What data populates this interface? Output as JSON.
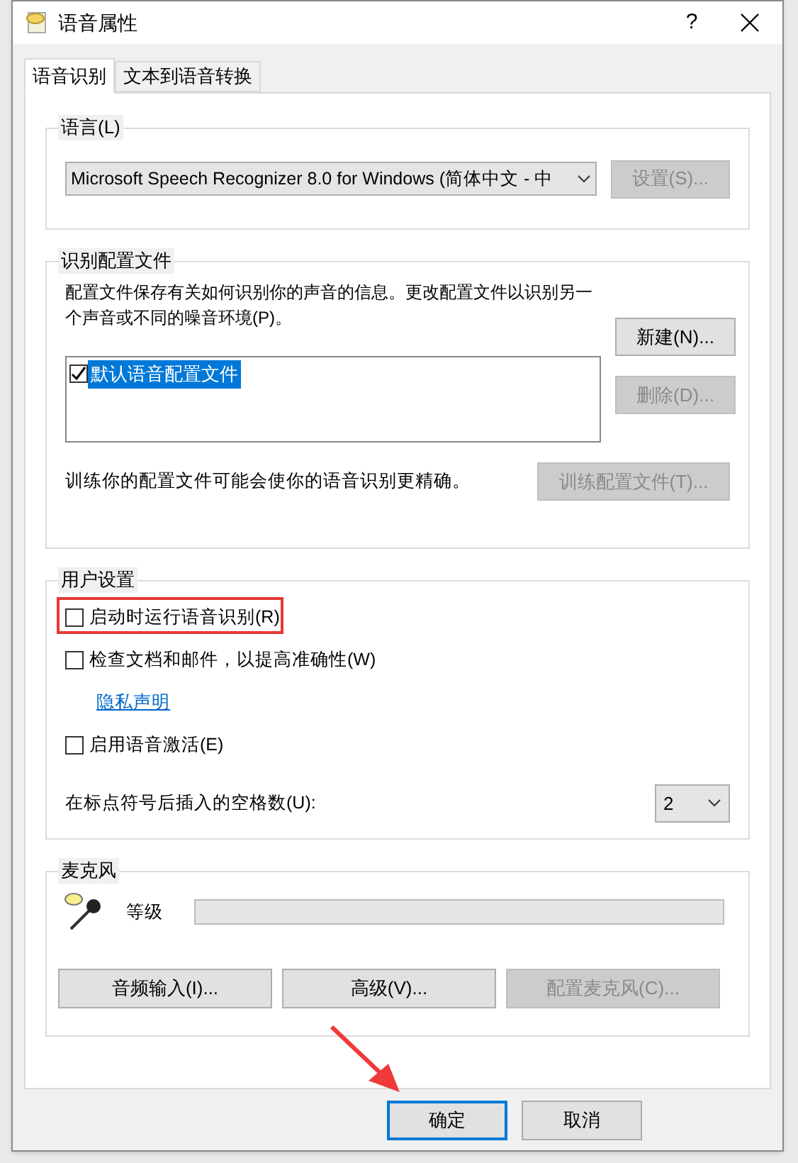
{
  "window": {
    "title": "语音属性",
    "help": "?"
  },
  "tabs": [
    {
      "label": "语音识别",
      "selected": true
    },
    {
      "label": "文本到语音转换",
      "selected": false
    }
  ],
  "language": {
    "legend": "语言(L)",
    "recognizer": "Microsoft Speech Recognizer 8.0 for Windows (简体中文 - 中",
    "settings_button": {
      "label": "设置(S)...",
      "disabled": true
    }
  },
  "profiles": {
    "legend": "识别配置文件",
    "description": "配置文件保存有关如何识别你的声音的信息。更改配置文件以识别另一个声音或不同的噪音环境(P)。",
    "new_button": {
      "label": "新建(N)...",
      "disabled": false
    },
    "delete_button": {
      "label": "删除(D)...",
      "disabled": true
    },
    "items": [
      {
        "label": "默认语音配置文件",
        "checked": true,
        "selected": true
      }
    ],
    "train_text": "训练你的配置文件可能会使你的语音识别更精确。",
    "train_button": {
      "label": "训练配置文件(T)...",
      "disabled": true
    }
  },
  "user_settings": {
    "legend": "用户设置",
    "options": [
      {
        "kind": "checkbox",
        "label": "启动时运行语音识别(R)",
        "checked": false,
        "highlighted": true
      },
      {
        "kind": "checkbox",
        "label": "检查文档和邮件，以提高准确性(W)",
        "checked": false,
        "highlighted": false
      },
      {
        "kind": "link",
        "label": "隐私声明"
      },
      {
        "kind": "checkbox",
        "label": "启用语音激活(E)",
        "checked": false,
        "highlighted": false
      }
    ],
    "spaces_label": "在标点符号后插入的空格数(U):",
    "spaces_value": "2"
  },
  "microphone": {
    "legend": "麦克风",
    "level_label": "等级",
    "level": 0,
    "buttons": [
      {
        "label": "音频输入(I)...",
        "disabled": false
      },
      {
        "label": "高级(V)...",
        "disabled": false
      },
      {
        "label": "配置麦克风(C)...",
        "disabled": true
      }
    ]
  },
  "footer_buttons": [
    {
      "label": "确定",
      "default": true
    },
    {
      "label": "取消",
      "default": false
    }
  ]
}
